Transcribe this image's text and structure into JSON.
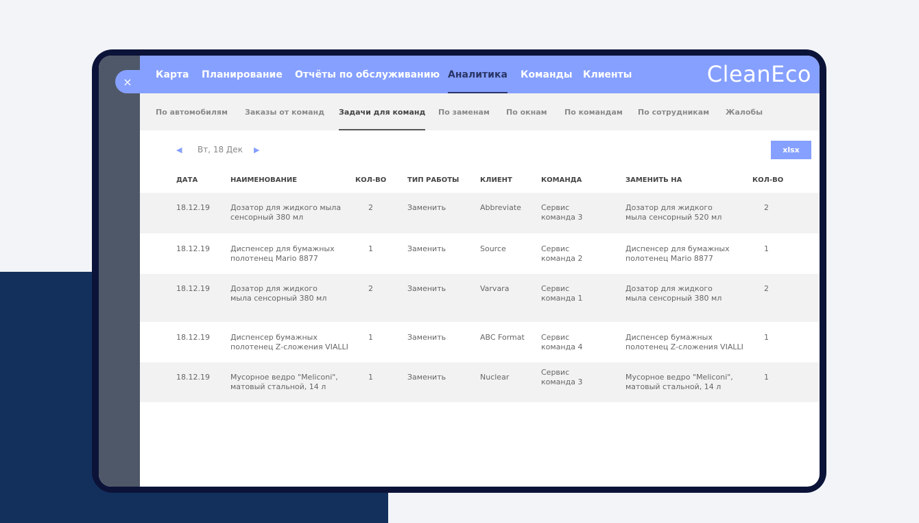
{
  "app": {
    "logo": "CleanEco",
    "close_icon": "×"
  },
  "nav": [
    "Карта",
    "Планирование",
    "Отчёты по обслуживанию",
    "Аналитика",
    "Команды",
    "Клиенты"
  ],
  "subnav": [
    "По автомобилям",
    "Заказы от команд",
    "Задачи для команд",
    "По заменам",
    "По окнам",
    "По командам",
    "По сотрудникам",
    "Жалобы"
  ],
  "toolbar": {
    "date": "Вт, 18 Дек",
    "prev": "◀",
    "next": "▶",
    "export": "xlsx"
  },
  "columns": [
    "ДАТА",
    "НАИМЕНОВАНИЕ",
    "КОЛ-ВО",
    "ТИП РАБОТЫ",
    "КЛИЕНТ",
    "КОМАНДА",
    "ЗАМЕНИТЬ НА",
    "КОЛ-ВО"
  ],
  "rows": [
    {
      "date": "18.12.19",
      "name1": "Дозатор для жидкого мыла",
      "name2": "сенсорный 380 мл",
      "qty": "2",
      "type": "Заменить",
      "client": "Abbreviate",
      "team1": "Сервис",
      "team2": "команда 3",
      "rep1": "Дозатор для жидкого",
      "rep2": "мыла сенсорный 520 мл",
      "qty2": "2"
    },
    {
      "date": "18.12.19",
      "name1": "Диспенсер для бумажных",
      "name2": "полотенец Mario 8877",
      "qty": "1",
      "type": "Заменить",
      "client": "Source",
      "team1": "Сервис",
      "team2": "команда 2",
      "rep1": "Диспенсер для бумажных",
      "rep2": "полотенец Mario 8877",
      "qty2": "1"
    },
    {
      "date": "18.12.19",
      "name1": "Дозатор для жидкого",
      "name2": "мыла сенсорный 380 мл",
      "qty": "2",
      "type": "Заменить",
      "client": "Varvara",
      "team1": "Сервис",
      "team2": "команда 1",
      "rep1": "Дозатор для жидкого",
      "rep2": "мыла сенсорный 380 мл",
      "qty2": "2"
    },
    {
      "date": "18.12.19",
      "name1": "Диспенсер бумажных",
      "name2": "полотенец Z-сложения VIALLI",
      "qty": "1",
      "type": "Заменить",
      "client": "ABC Format",
      "team1": "Сервис",
      "team2": "команда 4",
      "rep1": "Диспенсер бумажных",
      "rep2": "полотенец Z-сложения VIALLI",
      "qty2": "1"
    },
    {
      "date": "18.12.19",
      "name1": "Мусорное ведро \"Meliconi\",",
      "name2": "матовый стальной, 14 л",
      "qty": "1",
      "type": "Заменить",
      "client": "Nuclear",
      "team1": "Сервис",
      "team2": "команда 3",
      "rep1": "Мусорное ведро \"Meliconi\",",
      "rep2": "матовый стальной, 14 л",
      "qty2": "1"
    }
  ]
}
